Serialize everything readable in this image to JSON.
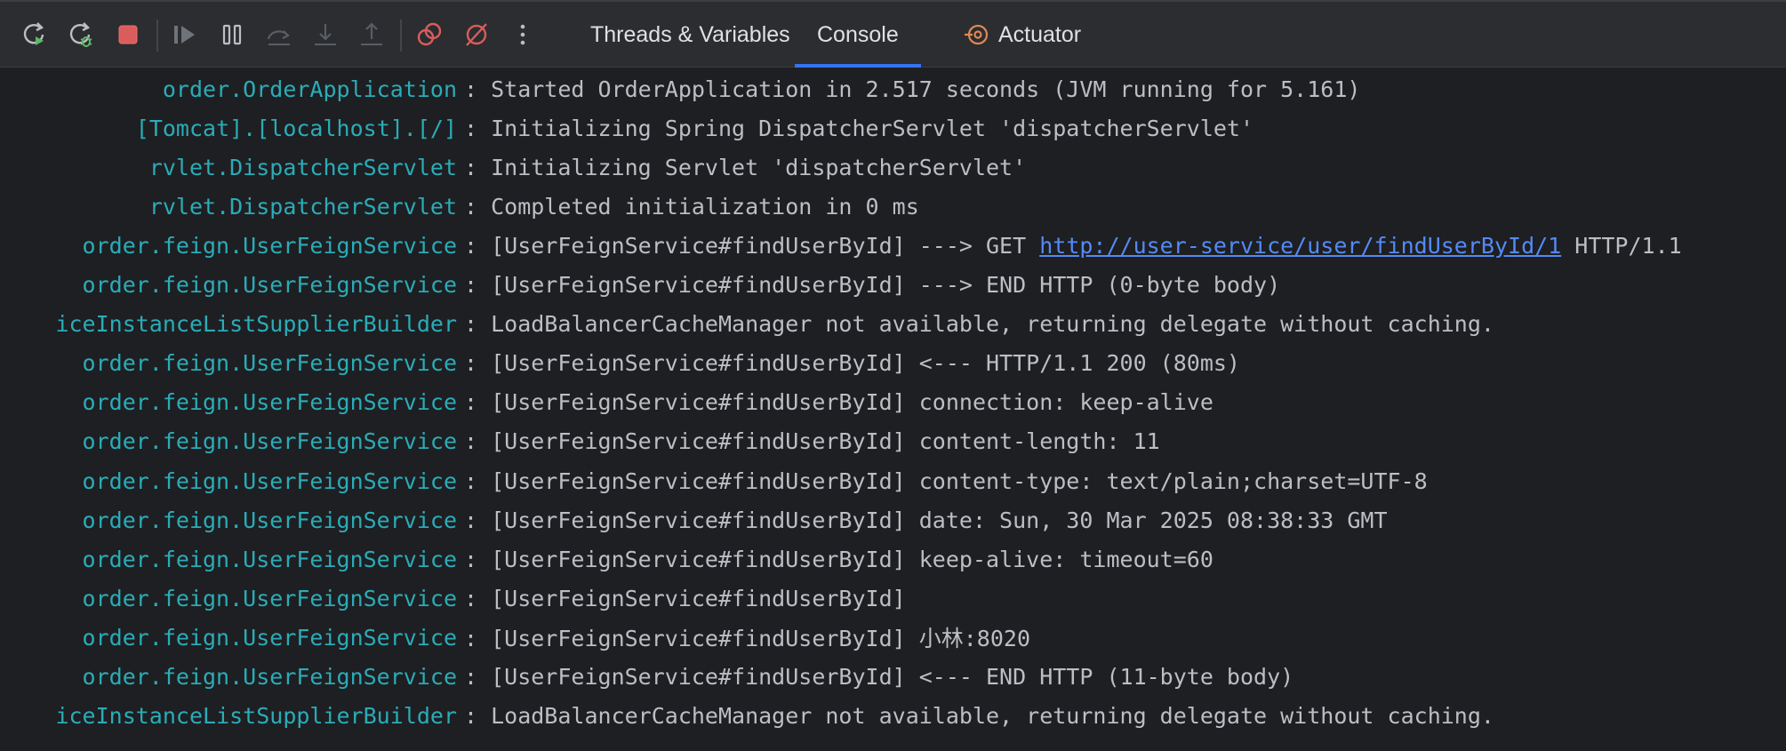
{
  "toolbar": {
    "buttons": [
      {
        "name": "rerun-icon"
      },
      {
        "name": "rerun-debug-icon"
      },
      {
        "name": "stop-icon"
      },
      {
        "name": "resume-icon"
      },
      {
        "name": "pause-icon"
      },
      {
        "name": "step-over-icon"
      },
      {
        "name": "step-into-icon"
      },
      {
        "name": "step-out-icon"
      },
      {
        "name": "view-breakpoints-icon"
      },
      {
        "name": "mute-breakpoints-icon"
      },
      {
        "name": "more-options-icon"
      }
    ],
    "tabs": [
      {
        "label": "Threads & Variables"
      },
      {
        "label": "Console"
      },
      {
        "label": "Actuator"
      }
    ],
    "active_tab": "Console"
  },
  "console": {
    "lines": [
      {
        "pkg": "order.",
        "cls": "OrderApplication",
        "msg": ": Started OrderApplication in 2.517 seconds (JVM running for 5.161)"
      },
      {
        "pkg": "[Tomcat].[localhost].[/]",
        "cls": "",
        "msg": ": Initializing Spring DispatcherServlet 'dispatcherServlet'"
      },
      {
        "pkg": "rvlet.",
        "cls": "DispatcherServlet",
        "msg": ": Initializing Servlet 'dispatcherServlet'"
      },
      {
        "pkg": "rvlet.",
        "cls": "DispatcherServlet",
        "msg": ": Completed initialization in 0 ms"
      },
      {
        "pkg": "order.feign.",
        "cls": "UserFeignService",
        "msg": ": [UserFeignService#findUserById] ---> GET ",
        "link": "http://user-service/user/findUserById/1",
        "msg_after": " HTTP/1.1"
      },
      {
        "pkg": "order.feign.",
        "cls": "UserFeignService",
        "msg": ": [UserFeignService#findUserById] ---> END HTTP (0-byte body)"
      },
      {
        "pkg": "",
        "cls": "iceInstanceListSupplierBuilder",
        "msg": ": LoadBalancerCacheManager not available, returning delegate without caching."
      },
      {
        "pkg": "order.feign.",
        "cls": "UserFeignService",
        "msg": ": [UserFeignService#findUserById] <--- HTTP/1.1 200 (80ms)"
      },
      {
        "pkg": "order.feign.",
        "cls": "UserFeignService",
        "msg": ": [UserFeignService#findUserById] connection: keep-alive"
      },
      {
        "pkg": "order.feign.",
        "cls": "UserFeignService",
        "msg": ": [UserFeignService#findUserById] content-length: 11"
      },
      {
        "pkg": "order.feign.",
        "cls": "UserFeignService",
        "msg": ": [UserFeignService#findUserById] content-type: text/plain;charset=UTF-8"
      },
      {
        "pkg": "order.feign.",
        "cls": "UserFeignService",
        "msg": ": [UserFeignService#findUserById] date: Sun, 30 Mar 2025 08:38:33 GMT"
      },
      {
        "pkg": "order.feign.",
        "cls": "UserFeignService",
        "msg": ": [UserFeignService#findUserById] keep-alive: timeout=60"
      },
      {
        "pkg": "order.feign.",
        "cls": "UserFeignService",
        "msg": ": [UserFeignService#findUserById]"
      },
      {
        "pkg": "order.feign.",
        "cls": "UserFeignService",
        "msg": ": [UserFeignService#findUserById] 小林:8020"
      },
      {
        "pkg": "order.feign.",
        "cls": "UserFeignService",
        "msg": ": [UserFeignService#findUserById] <--- END HTTP (11-byte body)"
      },
      {
        "pkg": "",
        "cls": "iceInstanceListSupplierBuilder",
        "msg": ": LoadBalancerCacheManager not available, returning delegate without caching."
      }
    ]
  },
  "colors": {
    "logger": "#2aacb8",
    "message": "#bcbec4",
    "link": "#548af7",
    "background": "#1e1f22",
    "toolbar": "#2b2d30",
    "stop": "#db5c5c",
    "run_green": "#5fb865",
    "actuator": "#e08855"
  }
}
